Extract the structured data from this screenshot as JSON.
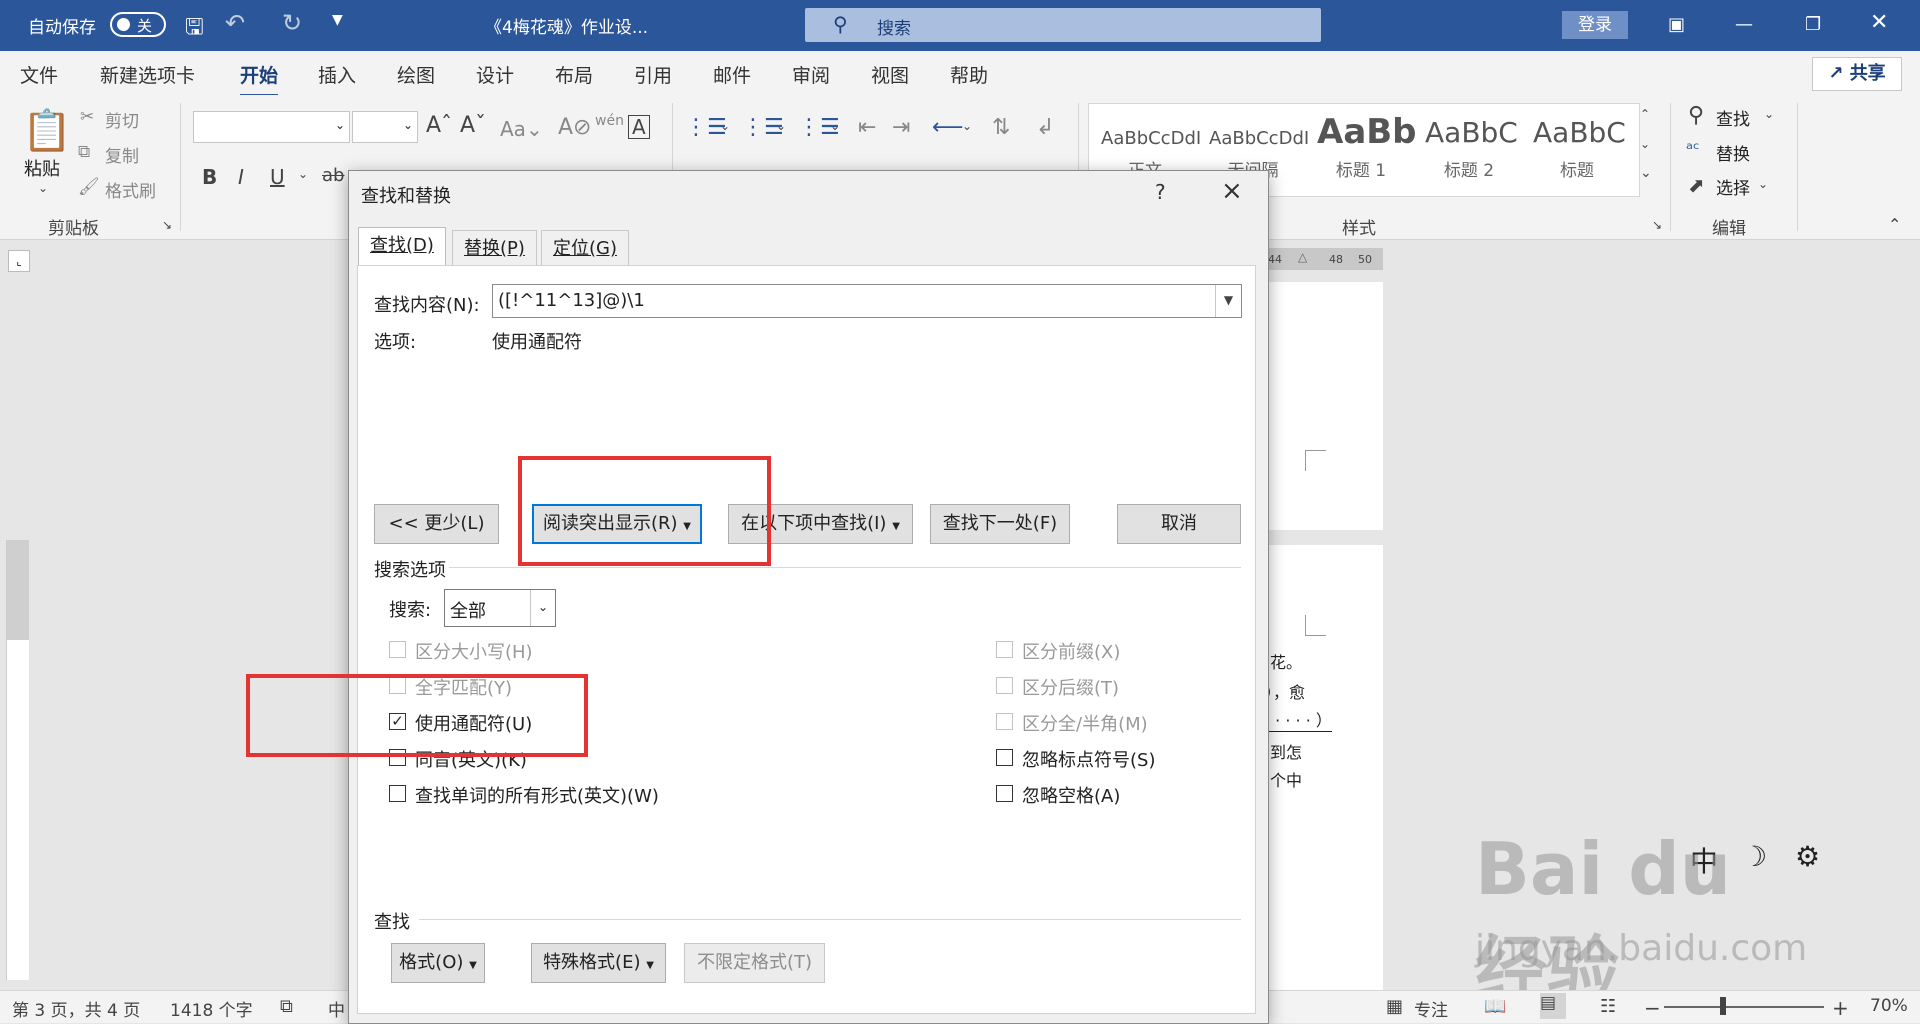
{
  "titlebar": {
    "autosave_label": "自动保存",
    "autosave_state": "关",
    "doc_title": "《4梅花魂》作业设...",
    "search_placeholder": "搜索",
    "login_label": "登录"
  },
  "menu": {
    "tabs": [
      "文件",
      "新建选项卡",
      "开始",
      "插入",
      "绘图",
      "设计",
      "布局",
      "引用",
      "邮件",
      "审阅",
      "视图",
      "帮助"
    ],
    "active_tab": "开始",
    "share_label": "共享"
  },
  "ribbon": {
    "clipboard": {
      "paste": "粘贴",
      "cut": "剪切",
      "copy": "复制",
      "format_painter": "格式刷",
      "group_label": "剪贴板"
    },
    "styles": {
      "items": [
        {
          "sample": "AaBbCcDdI",
          "name": "正文"
        },
        {
          "sample": "AaBbCcDdI",
          "name": "无间隔"
        },
        {
          "sample": "AaBb",
          "name": "标题 1"
        },
        {
          "sample": "AaBbC",
          "name": "标题 2"
        },
        {
          "sample": "AaBbC",
          "name": "标题"
        }
      ],
      "group_label": "样式"
    },
    "editing": {
      "find": "查找",
      "replace": "替换",
      "select": "选择",
      "group_label": "编辑"
    }
  },
  "ruler": {
    "marks": [
      "44",
      "48",
      "50"
    ]
  },
  "doc_fragments": [
    "花。",
    "），愈",
    "· · · · · ）",
    "到怎",
    "个中"
  ],
  "ime": {
    "lang": "中"
  },
  "dialog": {
    "title": "查找和替换",
    "help": "?",
    "tabs": [
      "查找(D)",
      "替换(P)",
      "定位(G)"
    ],
    "find_label": "查找内容(N):",
    "find_value": "([!^11^13]@)\\1",
    "options_label": "选项:",
    "options_value": "使用通配符",
    "buttons": {
      "less": "<< 更少(L)",
      "reading_highlight": "阅读突出显示(R)",
      "find_in": "在以下项中查找(I)",
      "find_next": "查找下一处(F)",
      "cancel": "取消"
    },
    "search_options_label": "搜索选项",
    "search_label": "搜索:",
    "search_value": "全部",
    "checkboxes_left": [
      {
        "label": "区分大小写(H)",
        "checked": false,
        "disabled": true
      },
      {
        "label": "全字匹配(Y)",
        "checked": false,
        "disabled": true
      },
      {
        "label": "使用通配符(U)",
        "checked": true,
        "disabled": false
      },
      {
        "label": "同音(英文)(K)",
        "checked": false,
        "disabled": false
      },
      {
        "label": "查找单词的所有形式(英文)(W)",
        "checked": false,
        "disabled": false
      }
    ],
    "checkboxes_right": [
      {
        "label": "区分前缀(X)",
        "checked": false,
        "disabled": true
      },
      {
        "label": "区分后缀(T)",
        "checked": false,
        "disabled": true
      },
      {
        "label": "区分全/半角(M)",
        "checked": false,
        "disabled": true
      },
      {
        "label": "忽略标点符号(S)",
        "checked": false,
        "disabled": false
      },
      {
        "label": "忽略空格(A)",
        "checked": false,
        "disabled": false
      }
    ],
    "find_section_label": "查找",
    "bottom_buttons": {
      "format": "格式(O)",
      "special": "特殊格式(E)",
      "no_format": "不限定格式(T)"
    }
  },
  "statusbar": {
    "page": "第 3 页，共 4 页",
    "words": "1418 个字",
    "lang": "中",
    "focus": "专注",
    "zoom": "70%"
  },
  "watermark": {
    "brand": "Bai du 经验",
    "url": "jingyan.baidu.com"
  }
}
